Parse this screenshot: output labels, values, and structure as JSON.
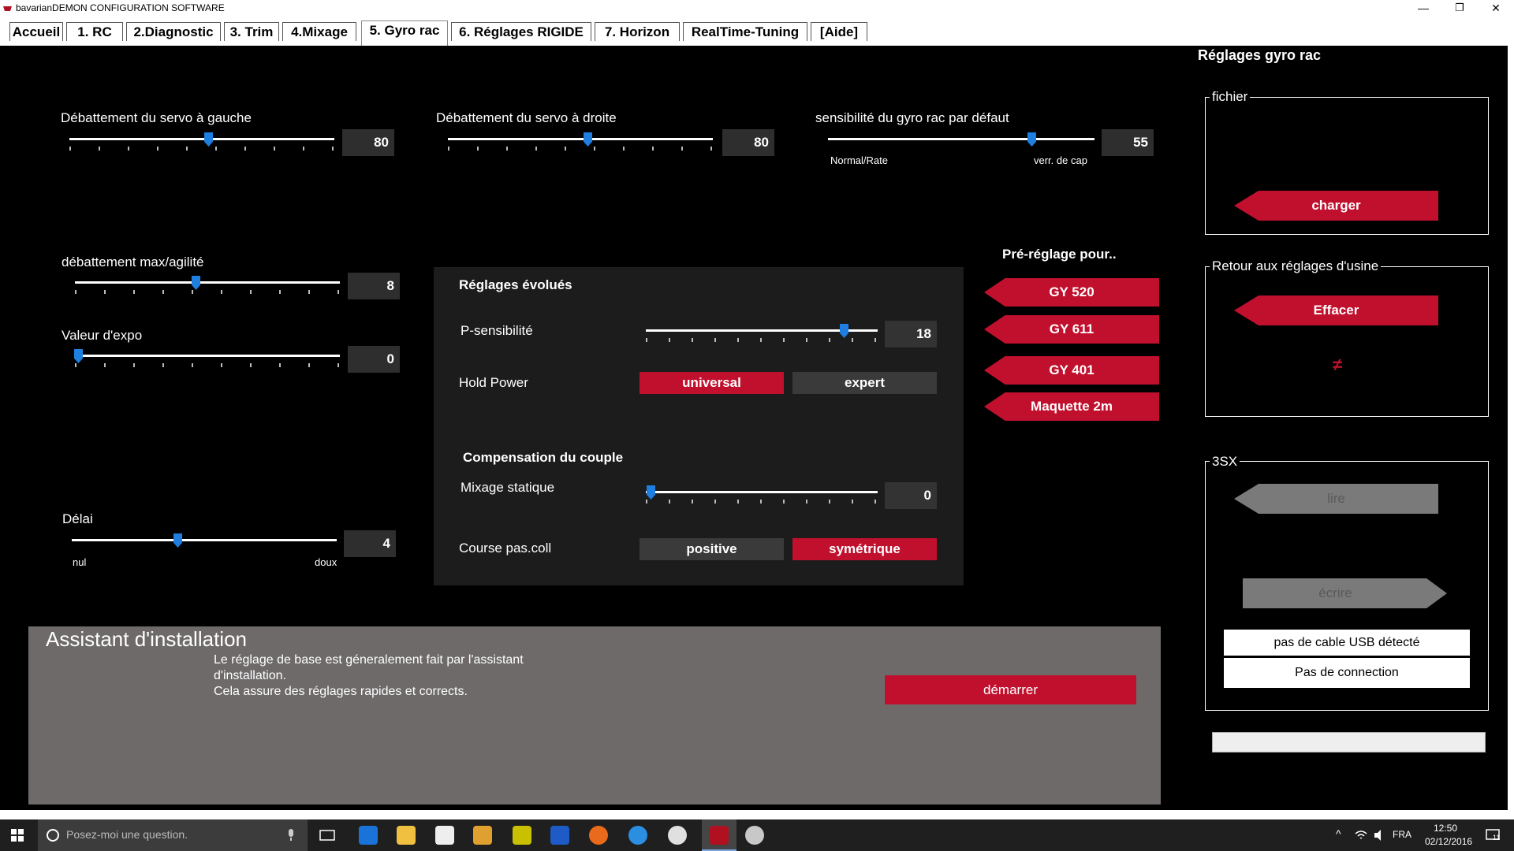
{
  "window": {
    "title": "bavarianDEMON CONFIGURATION SOFTWARE",
    "minimize": "—",
    "restore": "❐",
    "close": "✕"
  },
  "tabs": [
    "Accueil",
    "1. RC",
    "2.Diagnostic",
    "3. Trim",
    "4.Mixage",
    "5. Gyro rac",
    "6. Réglages RIGIDE",
    "7. Horizon",
    "RealTime-Tuning",
    "[Aide]"
  ],
  "active_tab": "5. Gyro rac",
  "sliders": {
    "servo_left": {
      "label": "Débattement du servo à gauche",
      "value": "80"
    },
    "servo_right": {
      "label": "Débattement du servo à droite",
      "value": "80"
    },
    "gyro_default": {
      "label": "sensibilité du gyro rac par défaut",
      "value": "55",
      "min_label": "Normal/Rate",
      "max_label": "verr. de cap"
    },
    "max_agility": {
      "label": "débattement max/agilité",
      "value": "8"
    },
    "expo": {
      "label": "Valeur d'expo",
      "value": "0"
    },
    "delay": {
      "label": "Délai",
      "value": "4",
      "min_label": "nul",
      "max_label": "doux"
    }
  },
  "advanced": {
    "title": "Réglages évolués",
    "p_sens_label": "P-sensibilité",
    "p_sens_value": "18",
    "hold_power_label": "Hold Power",
    "hold_universal": "universal",
    "hold_expert": "expert",
    "torque_title": "Compensation du couple",
    "static_mix_label": "Mixage statique",
    "static_mix_value": "0",
    "course_label": "Course pas.coll",
    "course_positive": "positive",
    "course_symmetric": "symétrique"
  },
  "presets": {
    "title": "Pré-réglage pour..",
    "items": [
      "GY 520",
      "GY 611",
      "GY 401",
      "Maquette 2m"
    ]
  },
  "assistant": {
    "title": "Assistant d'installation",
    "line1": "Le réglage de base est géneralement fait par l'assistant",
    "line2": "d'installation.",
    "line3": "Cela assure des réglages rapides et corrects.",
    "start": "démarrer"
  },
  "right": {
    "title": "Réglages gyro rac",
    "file_caption": "fichier",
    "load": "charger",
    "factory_caption": "Retour aux réglages d'usine",
    "erase": "Effacer",
    "not_equal": "≠",
    "sx_caption": "3SX",
    "read": "lire",
    "write": "écrire",
    "usb_status": "pas de cable USB détecté",
    "conn_status": "Pas de connection"
  },
  "taskbar": {
    "search_placeholder": "Posez-moi une question.",
    "lang": "FRA",
    "time": "12:50",
    "date": "02/12/2016",
    "notif_count": "11"
  },
  "colors": {
    "accent_red": "#c0102e",
    "slider_thumb": "#1f7fe0",
    "panel_dark": "#1c1c1c",
    "assistant_grey": "#6e6a6a"
  }
}
